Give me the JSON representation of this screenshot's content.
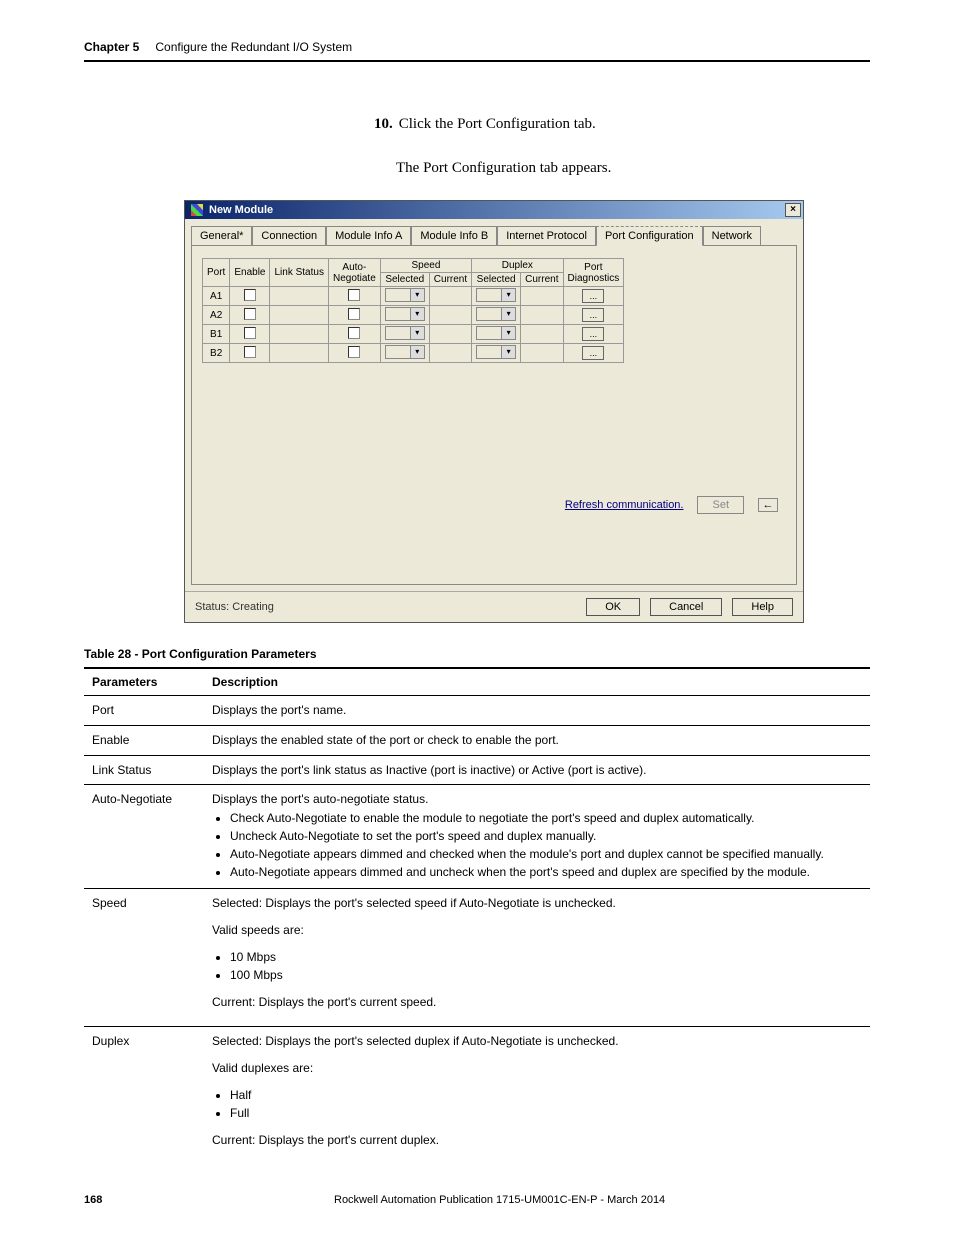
{
  "header": {
    "chapter": "Chapter 5",
    "title": "Configure the Redundant I/O System"
  },
  "step": {
    "num": "10.",
    "text": "Click the Port Configuration tab."
  },
  "followup": "The Port Configuration tab appears.",
  "dialog": {
    "title": "New Module",
    "close": "×",
    "tabs": [
      "General*",
      "Connection",
      "Module Info A",
      "Module Info B",
      "Internet Protocol",
      "Port Configuration",
      "Network"
    ],
    "activeTab": 5,
    "grid": {
      "head_row1": {
        "port": "Port",
        "enable": "Enable",
        "link": "Link Status",
        "auto": "Auto-\nNegotiate",
        "speed": "Speed",
        "duplex": "Duplex",
        "diag": "Port\nDiagnostics"
      },
      "head_row2": {
        "speed_sel": "Selected",
        "speed_cur": "Current",
        "dup_sel": "Selected",
        "dup_cur": "Current"
      },
      "rows": [
        {
          "port": "A1"
        },
        {
          "port": "A2"
        },
        {
          "port": "B1"
        },
        {
          "port": "B2"
        }
      ]
    },
    "refresh": "Refresh communication.",
    "set_btn": "Set",
    "arrow": "←",
    "status_label": "Status: Creating",
    "ok": "OK",
    "cancel": "Cancel",
    "help": "Help"
  },
  "table_caption": "Table 28 - Port Configuration Parameters",
  "param_headers": {
    "p": "Parameters",
    "d": "Description"
  },
  "params": {
    "port": {
      "name": "Port",
      "desc": "Displays the port's name."
    },
    "enable": {
      "name": "Enable",
      "desc": "Displays the enabled state of the port or check to enable the port."
    },
    "link": {
      "name": "Link Status",
      "desc": "Displays the port's link status as Inactive (port is inactive) or Active (port is active)."
    },
    "auto": {
      "name": "Auto-Negotiate",
      "lead": "Displays the port's auto-negotiate status.",
      "b1": "Check Auto-Negotiate to enable the module to negotiate the port's speed and duplex automatically.",
      "b2": "Uncheck Auto-Negotiate to set the port's speed and duplex manually.",
      "b3": "Auto-Negotiate appears dimmed and checked when the module's port and duplex cannot be specified manually.",
      "b4": "Auto-Negotiate appears dimmed and uncheck when the port's speed and duplex are specified by the module."
    },
    "speed": {
      "name": "Speed",
      "sel": "Selected: Displays the port's selected speed if Auto-Negotiate is unchecked.",
      "valid": "Valid speeds are:",
      "v1": "10 Mbps",
      "v2": "100 Mbps",
      "cur": "Current: Displays the port's current speed."
    },
    "duplex": {
      "name": "Duplex",
      "sel": "Selected: Displays the port's selected duplex if Auto-Negotiate is unchecked.",
      "valid": "Valid duplexes are:",
      "v1": "Half",
      "v2": "Full",
      "cur": "Current: Displays the port's current duplex."
    }
  },
  "footer": {
    "page": "168",
    "pub": "Rockwell Automation Publication 1715-UM001C-EN-P - March 2014"
  }
}
